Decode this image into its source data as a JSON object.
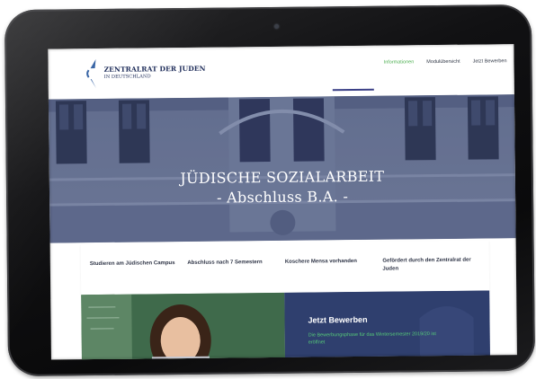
{
  "site": {
    "logo_line1": "ZENTRALRAT DER JUDEN",
    "logo_line2": "IN DEUTSCHLAND"
  },
  "nav": {
    "items": [
      {
        "label": "Informationen",
        "active": true
      },
      {
        "label": "Modulübersicht",
        "active": false
      },
      {
        "label": "Jetzt Bewerben",
        "active": false
      }
    ]
  },
  "hero": {
    "title": "JÜDISCHE SOZIALARBEIT",
    "subtitle": "- Abschluss B.A. -"
  },
  "features": [
    "Studieren am Jüdischen Campus",
    "Abschluss nach 7 Semestern",
    "Koschere Mensa vorhanden",
    "Gefördert durch den Zentralrat der Juden"
  ],
  "apply": {
    "title": "Jetzt Bewerben",
    "text": "Die Bewerbungsphase für das Wintersemester 2019/20 ist eröffnet"
  },
  "colors": {
    "accent_green": "#4caf50",
    "brand_navy": "#1f2d5a",
    "nav_underline": "#3a3f86",
    "apply_panel": "#2f3f6e"
  },
  "icons": {
    "logo": "zentralrat-logo-icon",
    "camera": "front-camera"
  }
}
